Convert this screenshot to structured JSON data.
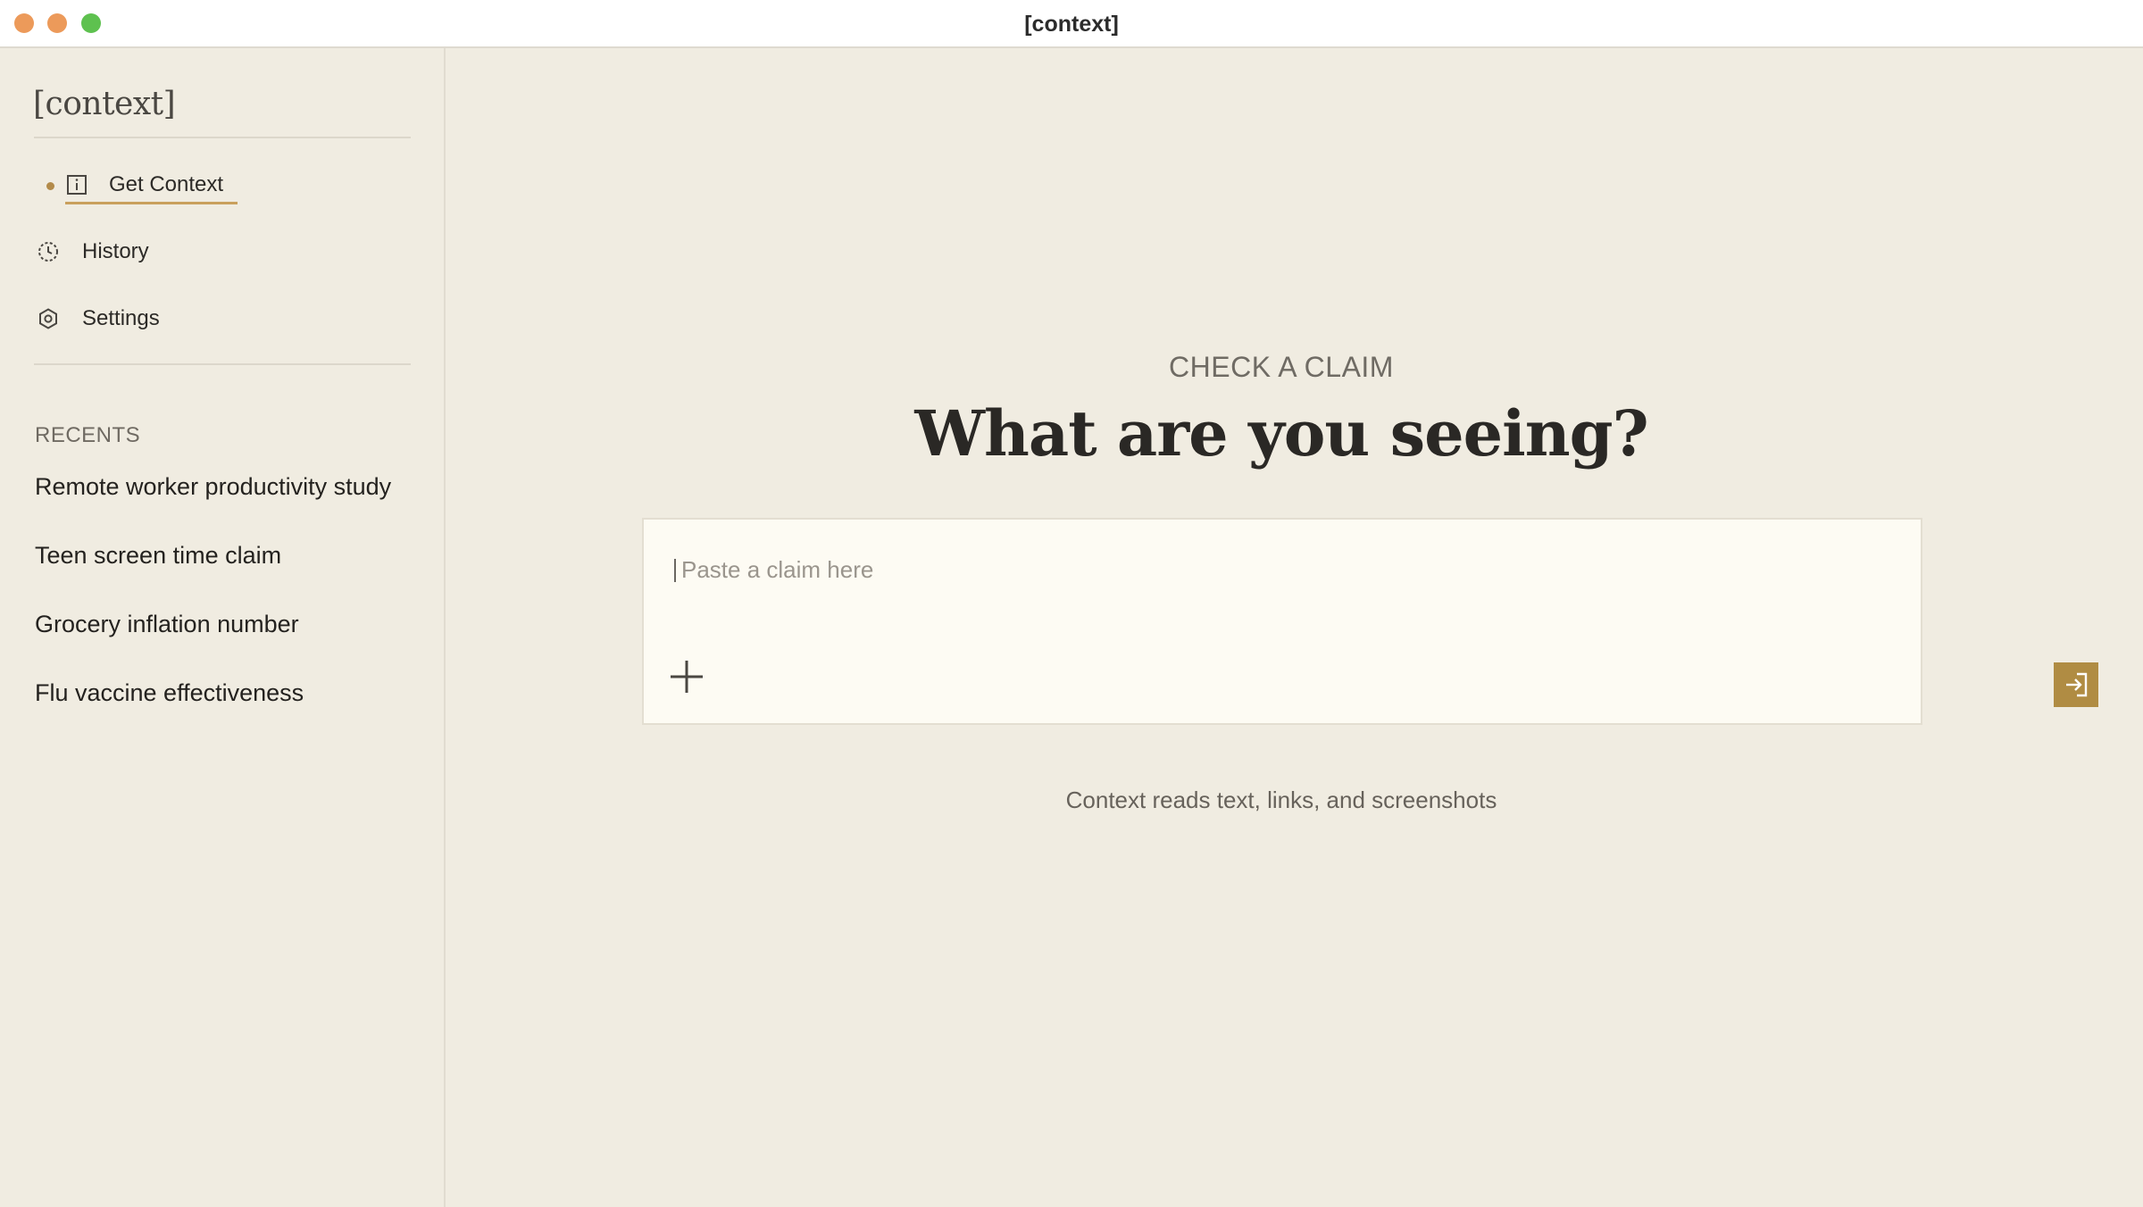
{
  "window": {
    "title": "[context]"
  },
  "sidebar": {
    "brand": "[context]",
    "nav": [
      {
        "label": "Get Context",
        "icon": "info-square-icon",
        "active": true
      },
      {
        "label": "History",
        "icon": "clock-icon",
        "active": false
      },
      {
        "label": "Settings",
        "icon": "gear-icon",
        "active": false
      }
    ],
    "recents_heading": "RECENTS",
    "recents": [
      "Remote worker productivity study",
      "Teen screen time claim",
      "Grocery inflation number",
      "Flu vaccine effectiveness"
    ]
  },
  "main": {
    "eyebrow": "CHECK A CLAIM",
    "headline": "What are you seeing?",
    "input": {
      "placeholder": "Paste a claim here",
      "value": ""
    },
    "attach_icon": "plus-icon",
    "submit_icon": "arrow-into-box-icon",
    "hint": "Context reads text, links, and screenshots"
  },
  "colors": {
    "background": "#f0ece1",
    "composer_bg": "#fdfbf3",
    "accent": "#b08c43",
    "active_underline": "#c9a05d"
  }
}
